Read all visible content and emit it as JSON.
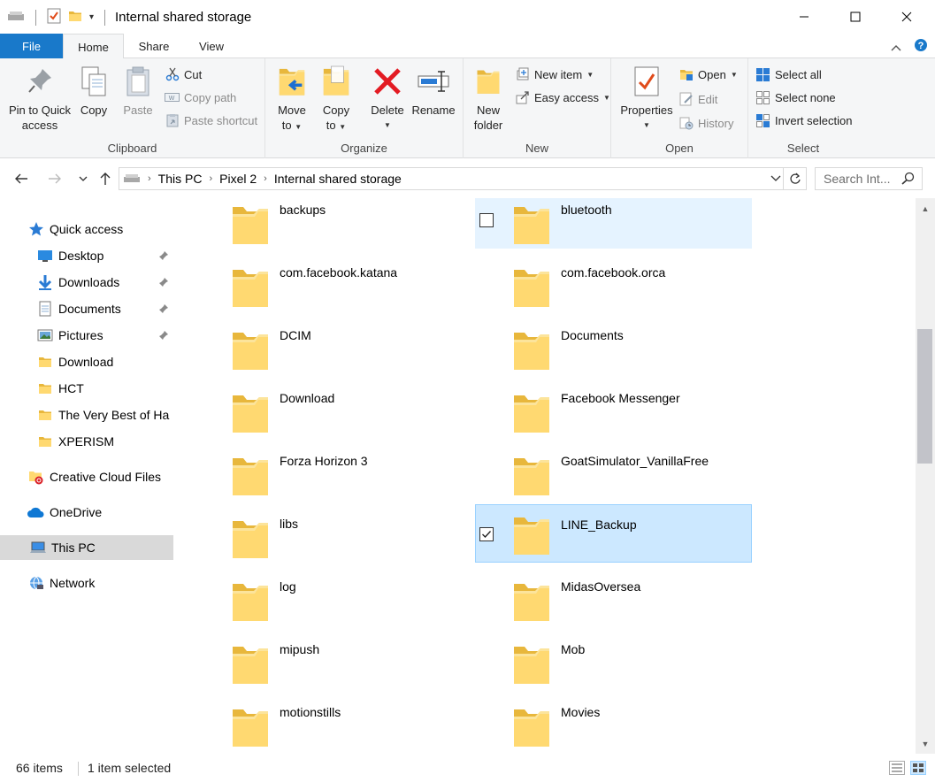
{
  "window": {
    "title": "Internal shared storage"
  },
  "ribbon_tabs": [
    "File",
    "Home",
    "Share",
    "View"
  ],
  "ribbon": {
    "clipboard": {
      "label": "Clipboard",
      "pin_line1": "Pin to Quick",
      "pin_line2": "access",
      "copy": "Copy",
      "paste": "Paste",
      "cut": "Cut",
      "copy_path": "Copy path",
      "paste_shortcut": "Paste shortcut"
    },
    "organize": {
      "label": "Organize",
      "move_line1": "Move",
      "move_line2": "to",
      "copy_line1": "Copy",
      "copy_line2": "to",
      "delete": "Delete",
      "rename": "Rename"
    },
    "new": {
      "label": "New",
      "folder_line1": "New",
      "folder_line2": "folder",
      "new_item": "New item",
      "easy_access": "Easy access"
    },
    "open": {
      "label": "Open",
      "properties": "Properties",
      "open": "Open",
      "edit": "Edit",
      "history": "History"
    },
    "select": {
      "label": "Select",
      "select_all": "Select all",
      "select_none": "Select none",
      "invert": "Invert selection"
    }
  },
  "address": {
    "crumbs": [
      "This PC",
      "Pixel 2",
      "Internal shared storage"
    ],
    "search_placeholder": "Search Int..."
  },
  "nav": {
    "quick_access": "Quick access",
    "items": [
      "Desktop",
      "Downloads",
      "Documents",
      "Pictures",
      "Download",
      "HCT",
      "The Very Best of Ha",
      "XPERISM"
    ],
    "creative_cloud": "Creative Cloud Files",
    "onedrive": "OneDrive",
    "this_pc": "This PC",
    "network": "Network"
  },
  "folders": {
    "left": [
      "backups",
      "com.facebook.katana",
      "DCIM",
      "Download",
      "Forza Horizon 3",
      "libs",
      "log",
      "mipush",
      "motionstills"
    ],
    "right": [
      "bluetooth",
      "com.facebook.orca",
      "Documents",
      "Facebook Messenger",
      "GoatSimulator_VanillaFree",
      "LINE_Backup",
      "MidasOversea",
      "Mob",
      "Movies"
    ]
  },
  "status": {
    "count": "66 items",
    "selected": "1 item selected"
  },
  "colors": {
    "accent": "#1979ca",
    "selection": "#cce8ff",
    "hover": "#e5f3ff",
    "folder": "#ffd971"
  }
}
